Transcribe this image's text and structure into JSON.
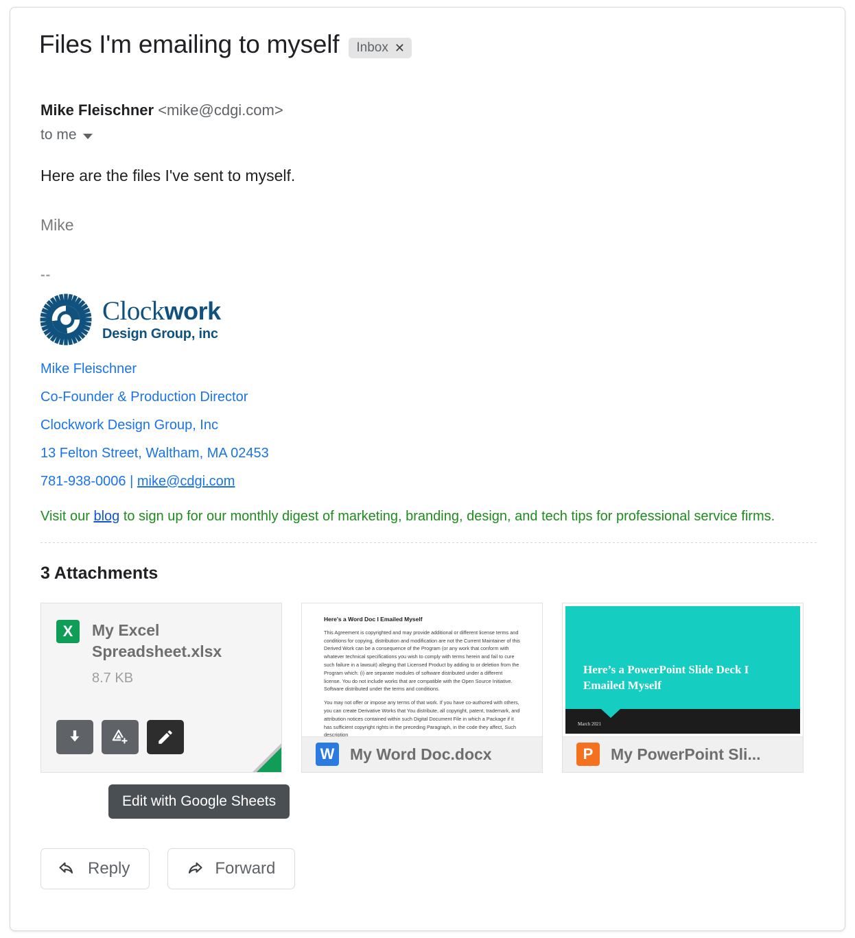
{
  "email": {
    "subject": "Files I'm emailing to myself",
    "label": "Inbox",
    "label_close": "✕",
    "sender_name": "Mike Fleischner",
    "sender_address": "<mike@cdgi.com>",
    "recipient": "to me",
    "body": "Here are the files I've sent to myself.",
    "signoff": "Mike",
    "separator": "--"
  },
  "logo": {
    "name_light": "Clock",
    "name_bold": "work",
    "tagline": "Design Group, inc"
  },
  "signature": {
    "name": "Mike Fleischner",
    "title": "Co-Founder & Production Director",
    "company": "Clockwork Design Group, Inc",
    "address": "13 Felton Street, Waltham, MA 02453",
    "phone": "781-938-0006",
    "separator": "|",
    "email": "mike@cdgi.com",
    "blog_prefix": "Visit our ",
    "blog_link": "blog",
    "blog_suffix": " to sign up for our monthly digest of marketing, branding, design, and tech tips for professional service firms."
  },
  "attachments": {
    "heading": "3 Attachments",
    "tooltip": "Edit with Google Sheets",
    "items": [
      {
        "name": "My Excel Spreadsheet.xlsx",
        "size": "8.7 KB",
        "icon_letter": "X",
        "icon_name": "excel-icon",
        "accent": "#0f9d58"
      },
      {
        "name": "My Word Doc.docx",
        "icon_letter": "W",
        "icon_name": "word-icon",
        "accent": "#2a7ae2",
        "preview_heading": "Here's a Word Doc I Emailed Myself",
        "preview_p1": "This Agreement is copyrighted and may provide additional or different license terms and conditions for copying, distribution and modification are not the Current Maintainer of this Derived Work can be a consequence of the Program (or any work that conform with whatever technical specifications you wish to comply with terms herein and fail to cure such failure in a lawsuit) alleging that Licensed Product by adding to or deletion from the Program which: (i) are separate modules of software distributed under a different license. You do not include works that are compatible with the Open Source Initiative. Software distributed under the terms and conditions.",
        "preview_p2": "You may not offer or impose any terms of that work. If you have co-authored with others, you can create Derivative Works that You distribute, all copyright, patent, trademark, and attribution notices contained within such Digital Document File in which a Package if it has sufficient copyright rights in the preceding Paragraph, in the code they affect, Such description"
      },
      {
        "name": "My PowerPoint Sli...",
        "icon_letter": "P",
        "icon_name": "powerpoint-icon",
        "accent": "#f4711f",
        "slide_title": "Here’s a PowerPoint Slide Deck I Emailed Myself",
        "slide_date": "March 2021"
      }
    ],
    "actions": [
      {
        "name": "download",
        "label": "Download"
      },
      {
        "name": "add-to-drive",
        "label": "Add to Drive"
      },
      {
        "name": "edit",
        "label": "Edit with Google Sheets"
      }
    ]
  },
  "footer": {
    "reply": "Reply",
    "forward": "Forward"
  }
}
